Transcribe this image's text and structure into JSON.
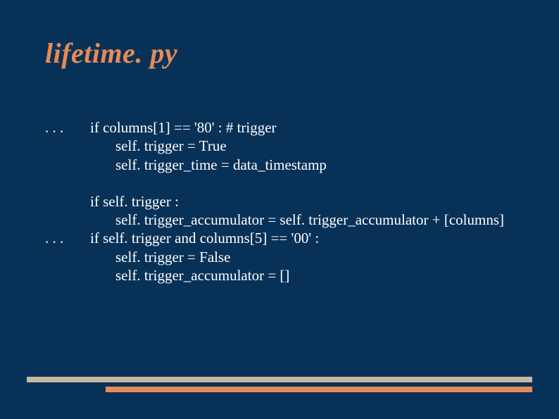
{
  "title": "lifetime. py",
  "ellipsis_top": ". . .",
  "ellipsis_mid": ". . .",
  "code": {
    "l1": "if columns[1] == '80' : # trigger",
    "l2": "self. trigger = True",
    "l3": "self. trigger_time = data_timestamp",
    "l4": "if self. trigger :",
    "l5": "self. trigger_accumulator = self. trigger_accumulator + [columns]",
    "l6": "if self. trigger and columns[5] == '00' :",
    "l7": "self. trigger = False",
    "l8": "self. trigger_accumulator = []"
  },
  "colors": {
    "background": "#083158",
    "title": "#e88a54",
    "text": "#ffffff",
    "bar_light": "#c5b7a0",
    "bar_orange": "#e88a54"
  }
}
